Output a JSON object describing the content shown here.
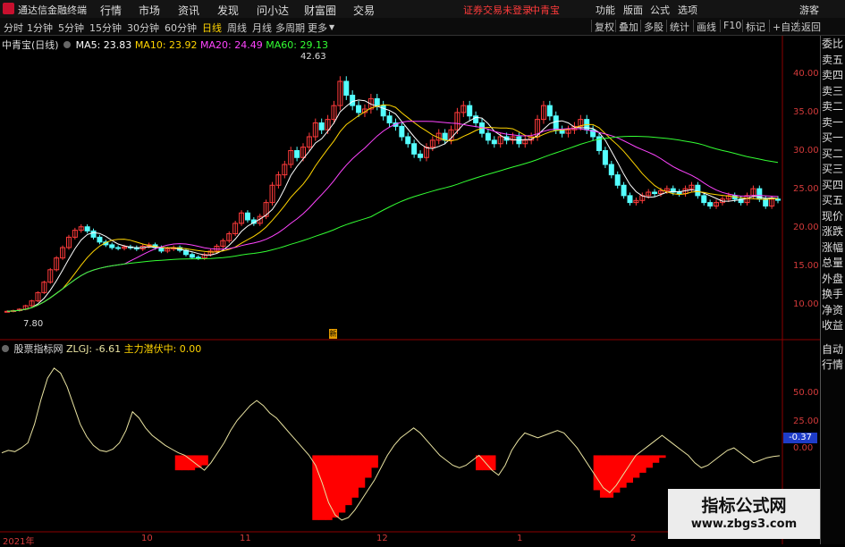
{
  "app": {
    "title": "通达信金融终端"
  },
  "menu": [
    "行情",
    "市场",
    "资讯",
    "发现",
    "问小达",
    "财富圈",
    "交易"
  ],
  "notice": "证券交易未登录",
  "stock_label": "中青宝",
  "right_menu": [
    "功能",
    "版面",
    "公式",
    "选项",
    "游客"
  ],
  "periods": [
    "分时",
    "1分钟",
    "5分钟",
    "15分钟",
    "30分钟",
    "60分钟",
    "日线",
    "周线",
    "月线",
    "多周期",
    "更多"
  ],
  "active_period": "日线",
  "tools": [
    "复权",
    "叠加",
    "多股",
    "统计",
    "画线",
    "F10",
    "标记",
    "+自选",
    "返回"
  ],
  "main_info": {
    "name": "中青宝(日线)",
    "ma5": "MA5: 23.83",
    "ma10": "MA10: 23.92",
    "ma20": "MA20: 24.49",
    "ma60": "MA60: 29.13"
  },
  "annotations": {
    "high": "42.63",
    "low": "7.80"
  },
  "y_labels": [
    "40.00",
    "35.00",
    "30.00",
    "25.00",
    "20.00",
    "15.00",
    "10.00"
  ],
  "sub_info": {
    "name": "股票指标网",
    "zlgj": "ZLGJ: -6.61",
    "zlqf": "主力潜伏中: 0.00"
  },
  "sub_y_labels": [
    "50.00",
    "25.00",
    "0.00"
  ],
  "sub_current": "-0.37",
  "x_labels": [
    "2021年",
    "10",
    "11",
    "12",
    "1",
    "2"
  ],
  "sidebar": [
    "委比",
    "卖五",
    "卖四",
    "卖三",
    "卖二",
    "卖一",
    "买一",
    "买二",
    "买三",
    "买四",
    "买五",
    "现价",
    "涨跌",
    "涨幅",
    "总量",
    "外盘",
    "换手",
    "净资",
    "收益"
  ],
  "sidebar2": [
    "自动",
    "行情"
  ],
  "watermark": {
    "line1": "指标公式网",
    "line2": "www.zbgs3.com"
  },
  "colors": {
    "up": "#ff3b3b",
    "down": "#54ffff",
    "ma5": "#ffffff",
    "ma10": "#ffd400",
    "ma20": "#ff44ff",
    "ma60": "#33ff33",
    "osc": "#e8e2a0",
    "bars": "#ff0000"
  },
  "chart_data": [
    {
      "type": "candlestick",
      "title": "中青宝(日线)",
      "ylim": [
        5,
        45
      ],
      "grid": false,
      "closes": [
        7.8,
        7.9,
        8.1,
        8.6,
        9.3,
        10.5,
        12.0,
        13.8,
        15.5,
        17.0,
        18.5,
        19.5,
        20.0,
        19.4,
        18.5,
        17.8,
        17.4,
        17.0,
        16.9,
        17.1,
        17.0,
        16.8,
        17.2,
        17.4,
        17.0,
        16.5,
        16.8,
        17.0,
        16.6,
        16.0,
        15.6,
        15.5,
        16.0,
        16.5,
        17.2,
        18.0,
        19.0,
        20.5,
        22.0,
        21.0,
        20.5,
        21.5,
        23.5,
        26.0,
        27.5,
        29.0,
        31.0,
        30.0,
        31.5,
        33.0,
        35.0,
        34.0,
        35.5,
        37.5,
        41.0,
        39.0,
        37.5,
        36.5,
        37.0,
        38.5,
        37.5,
        36.0,
        35.0,
        34.5,
        33.0,
        32.0,
        30.5,
        30.0,
        31.5,
        32.5,
        33.5,
        32.5,
        34.0,
        36.5,
        37.5,
        36.0,
        35.0,
        33.5,
        32.5,
        32.0,
        33.0,
        32.5,
        33.0,
        32.0,
        32.5,
        33.0,
        35.5,
        37.5,
        36.0,
        34.0,
        33.5,
        34.0,
        34.5,
        35.5,
        34.0,
        33.0,
        31.0,
        29.0,
        27.5,
        26.0,
        24.5,
        23.5,
        23.8,
        24.5,
        25.0,
        24.8,
        25.2,
        25.5,
        25.0,
        24.8,
        25.5,
        26.0,
        24.5,
        23.5,
        23.0,
        23.5,
        24.0,
        24.5,
        24.0,
        23.5,
        24.5,
        25.5,
        24.0,
        23.0,
        24.0,
        23.83
      ],
      "series": [
        {
          "name": "MA5",
          "last": 23.83
        },
        {
          "name": "MA10",
          "last": 23.92
        },
        {
          "name": "MA20",
          "last": 24.49
        },
        {
          "name": "MA60",
          "last": 29.13
        }
      ],
      "x_tick_labels": [
        "2021年",
        "10",
        "11",
        "12",
        "1",
        "2"
      ]
    },
    {
      "type": "line",
      "title": "股票指标网",
      "series": [
        {
          "name": "ZLGJ",
          "values": [
            2,
            4,
            3,
            6,
            10,
            25,
            45,
            62,
            70,
            66,
            55,
            40,
            25,
            15,
            8,
            4,
            3,
            5,
            10,
            20,
            35,
            30,
            22,
            16,
            12,
            8,
            5,
            2,
            0,
            -4,
            -8,
            -12,
            -6,
            2,
            10,
            20,
            28,
            34,
            40,
            44,
            40,
            34,
            30,
            24,
            18,
            12,
            6,
            0,
            -8,
            -22,
            -38,
            -48,
            -52,
            -50,
            -44,
            -36,
            -28,
            -20,
            -10,
            0,
            8,
            14,
            18,
            22,
            18,
            12,
            6,
            0,
            -4,
            -8,
            -10,
            -8,
            -4,
            0,
            -6,
            -12,
            -16,
            -8,
            4,
            12,
            18,
            16,
            14,
            16,
            18,
            20,
            18,
            12,
            6,
            -2,
            -10,
            -18,
            -26,
            -30,
            -24,
            -16,
            -8,
            0,
            4,
            8,
            12,
            16,
            12,
            8,
            4,
            0,
            -6,
            -10,
            -8,
            -4,
            0,
            4,
            6,
            2,
            -2,
            -6,
            -4,
            -2,
            -1,
            -0.37
          ]
        },
        {
          "name": "主力潜伏中",
          "values": [
            0,
            0,
            0,
            0,
            0,
            0,
            0,
            0,
            0,
            0,
            0,
            0,
            0,
            0,
            0,
            0,
            0,
            0,
            0,
            0,
            0,
            0,
            0,
            0,
            0,
            0,
            0,
            -12,
            -12,
            -12,
            -10,
            -8,
            0,
            0,
            0,
            0,
            0,
            0,
            0,
            0,
            0,
            0,
            0,
            0,
            0,
            0,
            0,
            0,
            -52,
            -52,
            -52,
            -50,
            -46,
            -40,
            -34,
            -26,
            -18,
            -10,
            0,
            0,
            0,
            0,
            0,
            0,
            0,
            0,
            0,
            0,
            0,
            0,
            0,
            0,
            0,
            -12,
            -12,
            -12,
            0,
            0,
            0,
            0,
            0,
            0,
            0,
            0,
            0,
            0,
            0,
            0,
            0,
            0,
            0,
            -28,
            -34,
            -34,
            -30,
            -26,
            -22,
            -18,
            -14,
            -10,
            -6,
            -2,
            0,
            0,
            0,
            0,
            0,
            0,
            0,
            0,
            0,
            0,
            0,
            0,
            0,
            0,
            0,
            0,
            0,
            0,
            0,
            0,
            0,
            0,
            0,
            0
          ]
        }
      ],
      "ylim": [
        -60,
        80
      ]
    }
  ]
}
